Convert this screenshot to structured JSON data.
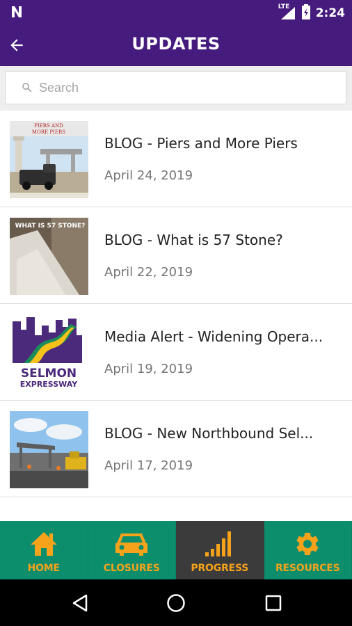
{
  "status_bar": {
    "time": "2:24",
    "network_label": "LTE",
    "left_icon": "n-icon"
  },
  "header": {
    "title": "UPDATES",
    "back_icon": "arrow-left-icon"
  },
  "search": {
    "placeholder": "Search",
    "value": ""
  },
  "thumbnails": {
    "piers_caption_line1": "PIERS AND",
    "piers_caption_line2": "MORE PIERS",
    "stone_caption": "WHAT IS 57 STONE?",
    "logo_line1": "SELMON",
    "logo_line2": "EXPRESSWAY"
  },
  "items": [
    {
      "title": "BLOG - Piers and More Piers",
      "date": "April 24, 2019",
      "thumb": "piers-photo"
    },
    {
      "title": "BLOG - What is 57 Stone?",
      "date": "April 22, 2019",
      "thumb": "stone-photo"
    },
    {
      "title": "Media Alert - Widening Opera...",
      "date": "April 19, 2019",
      "thumb": "selmon-logo"
    },
    {
      "title": "BLOG - New Northbound Sel...",
      "date": "April 17, 2019",
      "thumb": "construction-photo"
    }
  ],
  "bottom_nav": [
    {
      "label": "HOME",
      "icon": "home-icon",
      "active": false
    },
    {
      "label": "CLOSURES",
      "icon": "car-icon",
      "active": false
    },
    {
      "label": "PROGRESS",
      "icon": "signal-bars-icon",
      "active": true
    },
    {
      "label": "RESOURCES",
      "icon": "gear-icon",
      "active": false
    }
  ],
  "colors": {
    "primary": "#461b7e",
    "nav_bg": "#0c8e6d",
    "nav_active": "#3b3b3b",
    "accent": "#f6a21b"
  }
}
